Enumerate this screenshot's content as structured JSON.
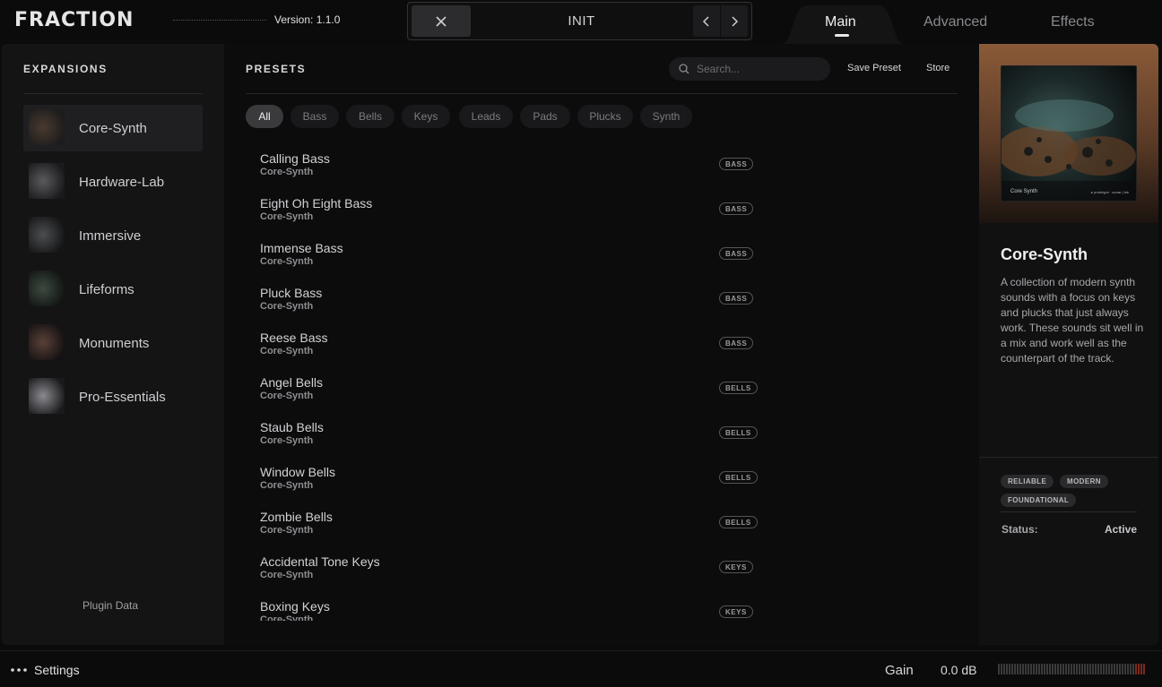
{
  "app": {
    "logo": "FRACTION",
    "version": "Version: 1.1.0"
  },
  "preset_bar": {
    "current_preset": "INIT",
    "close_icon": "close-icon",
    "prev_icon": "chevron-left-icon",
    "next_icon": "chevron-right-icon"
  },
  "tabs": [
    {
      "label": "Main",
      "active": true
    },
    {
      "label": "Advanced",
      "active": false
    },
    {
      "label": "Effects",
      "active": false
    }
  ],
  "expansions": {
    "title": "EXPANSIONS",
    "items": [
      {
        "label": "Core-Synth",
        "active": true
      },
      {
        "label": "Hardware-Lab",
        "active": false
      },
      {
        "label": "Immersive",
        "active": false
      },
      {
        "label": "Lifeforms",
        "active": false
      },
      {
        "label": "Monuments",
        "active": false
      },
      {
        "label": "Pro-Essentials",
        "active": false
      }
    ],
    "footer": "Plugin Data"
  },
  "presets": {
    "title": "PRESETS",
    "search_placeholder": "Search...",
    "save_preset": "Save Preset",
    "store": "Store",
    "filters": [
      {
        "label": "All",
        "active": true
      },
      {
        "label": "Bass",
        "active": false
      },
      {
        "label": "Bells",
        "active": false
      },
      {
        "label": "Keys",
        "active": false
      },
      {
        "label": "Leads",
        "active": false
      },
      {
        "label": "Pads",
        "active": false
      },
      {
        "label": "Plucks",
        "active": false
      },
      {
        "label": "Synth",
        "active": false
      }
    ],
    "items": [
      {
        "name": "Calling Bass",
        "expansion": "Core-Synth",
        "tag": "BASS"
      },
      {
        "name": "Eight Oh Eight Bass",
        "expansion": "Core-Synth",
        "tag": "BASS"
      },
      {
        "name": "Immense Bass",
        "expansion": "Core-Synth",
        "tag": "BASS"
      },
      {
        "name": "Pluck Bass",
        "expansion": "Core-Synth",
        "tag": "BASS"
      },
      {
        "name": "Reese Bass",
        "expansion": "Core-Synth",
        "tag": "BASS"
      },
      {
        "name": "Angel Bells",
        "expansion": "Core-Synth",
        "tag": "BELLS"
      },
      {
        "name": "Staub Bells",
        "expansion": "Core-Synth",
        "tag": "BELLS"
      },
      {
        "name": "Window Bells",
        "expansion": "Core-Synth",
        "tag": "BELLS"
      },
      {
        "name": "Zombie Bells",
        "expansion": "Core-Synth",
        "tag": "BELLS"
      },
      {
        "name": "Accidental Tone Keys",
        "expansion": "Core-Synth",
        "tag": "KEYS"
      },
      {
        "name": "Boxing Keys",
        "expansion": "Core-Synth",
        "tag": "KEYS"
      }
    ]
  },
  "detail": {
    "cover_label": "Core Synth",
    "cover_credit": "▸ prototype · sonar | lab",
    "title": "Core-Synth",
    "description": "A collection of modern synth sounds with a focus on keys and plucks that just always work. These sounds sit well in a mix and work well as the counterpart of the track.",
    "tags": [
      "RELIABLE",
      "MODERN",
      "FOUNDATIONAL"
    ],
    "status_label": "Status:",
    "status_value": "Active"
  },
  "footer": {
    "settings": "Settings",
    "gain_label": "Gain",
    "gain_value": "0.0 dB"
  },
  "colors": {
    "accent_active": "#3a3a3d",
    "meter_tick": "#3a3a3a",
    "meter_peak": "#7a2a1e"
  }
}
